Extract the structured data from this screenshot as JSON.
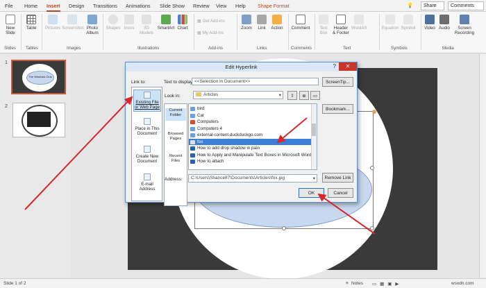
{
  "tabs": [
    "File",
    "Home",
    "Insert",
    "Design",
    "Transitions",
    "Animations",
    "Slide Show",
    "Review",
    "View",
    "Help",
    "Shape Format"
  ],
  "active_tab": "Insert",
  "search_glyph": "💡",
  "share_label": "Share",
  "comments_label": "Comments",
  "ribbon": {
    "new_slide": "New Slide",
    "table": "Table",
    "pictures": "Pictures",
    "screenshot": "Screenshot",
    "photo_album": "Photo Album",
    "shapes": "Shapes",
    "icons": "Icons",
    "models_3d": "3D Models",
    "smartart": "SmartArt",
    "chart": "Chart",
    "get_addins": "Get Add-ins",
    "my_addins": "My Add-ins",
    "zoom": "Zoom",
    "link": "Link",
    "action": "Action",
    "comment": "Comment",
    "text_box": "Text Box",
    "header_footer": "Header & Footer",
    "wordart": "WordArt",
    "equation": "Equation",
    "symbol": "Symbol",
    "video": "Video",
    "audio": "Audio",
    "screen_recording": "Screen Recording",
    "groups": {
      "slides": "Slides",
      "tables": "Tables",
      "images": "Images",
      "illustrations": "Illustrations",
      "addins": "Add-ins",
      "links": "Links",
      "comments": "Comments",
      "text": "Text",
      "symbols": "Symbols",
      "media": "Media"
    }
  },
  "slides": {
    "first_num": "1",
    "second_num": "2",
    "first_thumb_text": "The Windows Club"
  },
  "dialog": {
    "title": "Edit Hyperlink",
    "close_glyph": "✕",
    "help_glyph": "?",
    "link_to_label": "Link to:",
    "text_display_label": "Text to display:",
    "text_display_value": "<<Selection in Document>>",
    "screentip": "ScreenTip...",
    "look_in_label": "Look in:",
    "look_in_value": "Articles",
    "bookmark": "Bookmark...",
    "remove_link": "Remove Link",
    "address_label": "Address:",
    "address_value": "C:\\Users\\Shance87\\Documents\\Articles\\fox.jpg",
    "ok": "OK",
    "cancel": "Cancel",
    "link_to_items": [
      "Existing File or Web Page",
      "Place in This Document",
      "Create New Document",
      "E-mail Address"
    ],
    "shortcuts": [
      "Current Folder",
      "Browsed Pages",
      "Recent Files"
    ],
    "files": [
      "bird",
      "Cat",
      "Computers",
      "Computers 4",
      "external-content.duckduckgo.com",
      "fox",
      "How to add drop shadow in pain",
      "How to Apply and Manipulate Text Boxes in Microsoft Word",
      "How to attach"
    ],
    "selected_file": "fox"
  },
  "status": {
    "slide_count": "Slide 1 of 2",
    "notes": "Notes",
    "watermark": "wsxdn.com"
  },
  "colors": {
    "accent": "#b7472a",
    "selection": "#3c7fd6",
    "arrow": "#d9262a"
  }
}
